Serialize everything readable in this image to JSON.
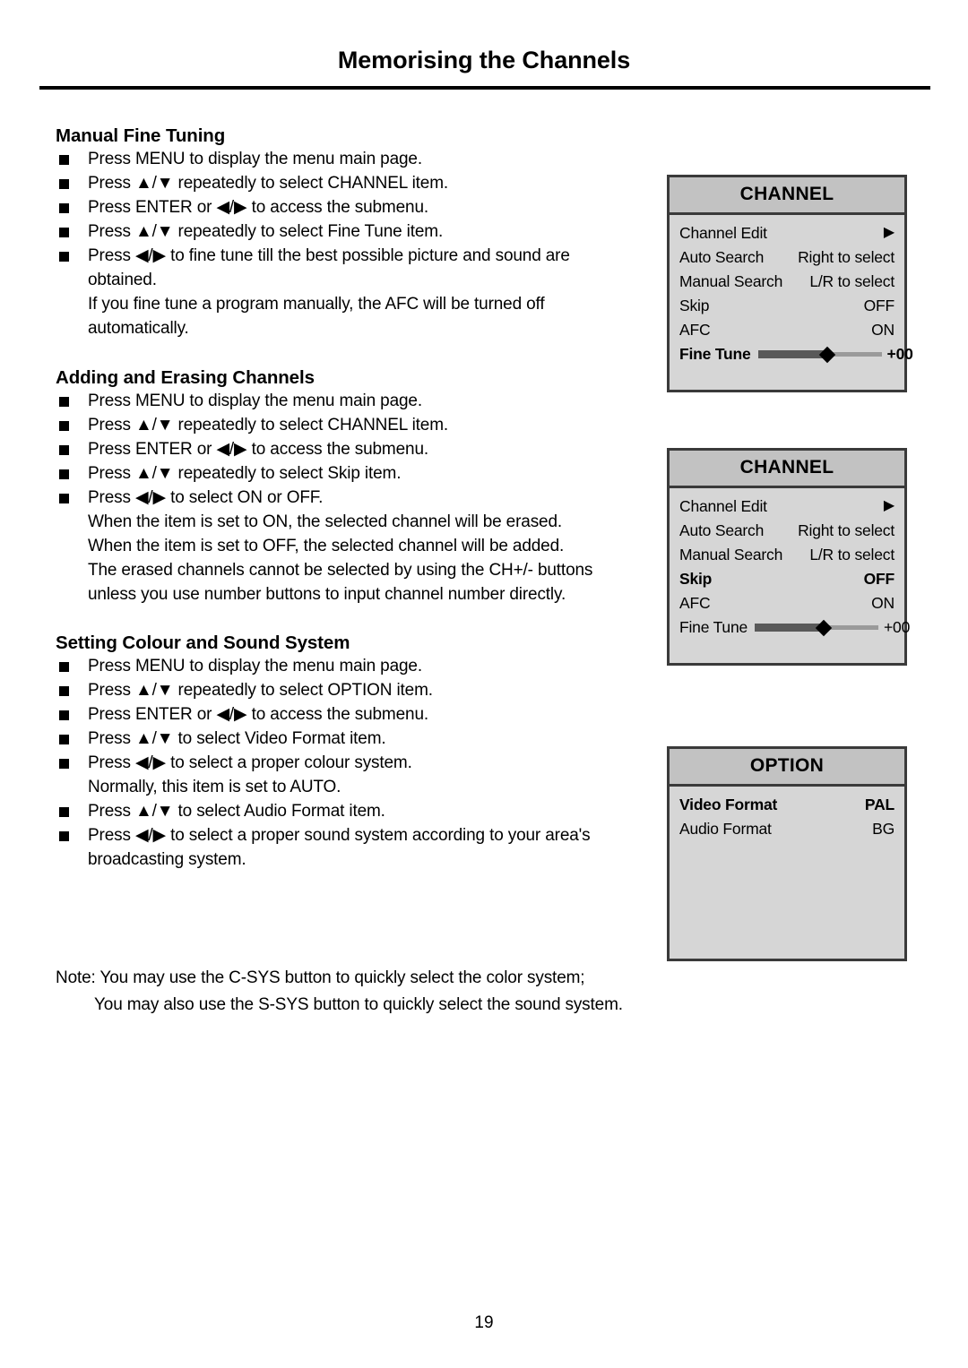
{
  "document": {
    "title": "Memorising the Channels",
    "page_number": "19"
  },
  "sections": [
    {
      "heading": "Manual Fine Tuning",
      "items": [
        {
          "type": "bullet",
          "text": "Press MENU to display the menu main page."
        },
        {
          "type": "bullet",
          "text": "Press ▲/▼ repeatedly to select CHANNEL item."
        },
        {
          "type": "bullet",
          "text": "Press ENTER or ◀/▶ to access the submenu."
        },
        {
          "type": "bullet",
          "text": "Press ▲/▼ repeatedly to select Fine Tune item."
        },
        {
          "type": "bullet",
          "text": "Press ◀/▶ to fine tune till the best possible picture and sound are"
        },
        {
          "type": "cont",
          "text": "obtained."
        },
        {
          "type": "cont",
          "text": "If you fine tune a program manually, the AFC will be turned off"
        },
        {
          "type": "cont",
          "text": "automatically."
        }
      ]
    },
    {
      "heading": "Adding and Erasing Channels",
      "items": [
        {
          "type": "bullet",
          "text": "Press MENU to display the menu main page."
        },
        {
          "type": "bullet",
          "text": "Press ▲/▼ repeatedly to select CHANNEL item."
        },
        {
          "type": "bullet",
          "text": "Press ENTER or ◀/▶ to access the submenu."
        },
        {
          "type": "bullet",
          "text": "Press ▲/▼ repeatedly to select Skip item."
        },
        {
          "type": "bullet",
          "text": "Press ◀/▶ to select ON or OFF."
        },
        {
          "type": "cont",
          "text": "When the item is set to ON, the selected channel will be erased."
        },
        {
          "type": "cont",
          "text": "When the item is set to OFF, the selected channel will be added."
        },
        {
          "type": "cont",
          "text": "The erased channels cannot be selected by using the CH+/- buttons"
        },
        {
          "type": "cont",
          "text": "unless you use number buttons to input channel number directly."
        }
      ]
    },
    {
      "heading": "Setting Colour and Sound System",
      "items": [
        {
          "type": "bullet",
          "text": "Press MENU to display the menu main page."
        },
        {
          "type": "bullet",
          "text": "Press ▲/▼ repeatedly to select OPTION item."
        },
        {
          "type": "bullet",
          "text": "Press ENTER or ◀/▶ to access the submenu."
        },
        {
          "type": "bullet",
          "text": "Press ▲/▼ to select Video Format item."
        },
        {
          "type": "bullet",
          "text": "Press ◀/▶ to select a proper colour system."
        },
        {
          "type": "cont",
          "text": "Normally, this item is set to AUTO."
        },
        {
          "type": "bullet",
          "text": "Press ▲/▼ to select Audio Format item."
        },
        {
          "type": "bullet",
          "text": "Press ◀/▶ to select a proper sound system according to your area's"
        },
        {
          "type": "cont",
          "text": "broadcasting system."
        }
      ]
    }
  ],
  "note": {
    "line1": "Note: You may use the C-SYS button to quickly select the color system;",
    "line2": "You may also use the S-SYS button to quickly select the sound system."
  },
  "osd": {
    "channel_fine_tune": {
      "title": "CHANNEL",
      "rows": [
        {
          "label": "Channel Edit",
          "value": "▶",
          "selected": false,
          "kind": "arrow"
        },
        {
          "label": "Auto Search",
          "value": "Right to select",
          "selected": false,
          "kind": "text"
        },
        {
          "label": "Manual Search",
          "value": "L/R to select",
          "selected": false,
          "kind": "text"
        },
        {
          "label": "Skip",
          "value": "OFF",
          "selected": false,
          "kind": "text"
        },
        {
          "label": "AFC",
          "value": "ON",
          "selected": false,
          "kind": "text"
        },
        {
          "label": "Fine Tune",
          "value": "+00",
          "selected": true,
          "kind": "slider"
        }
      ]
    },
    "channel_skip": {
      "title": "CHANNEL",
      "rows": [
        {
          "label": "Channel Edit",
          "value": "▶",
          "selected": false,
          "kind": "arrow"
        },
        {
          "label": "Auto Search",
          "value": "Right to select",
          "selected": false,
          "kind": "text"
        },
        {
          "label": "Manual Search",
          "value": "L/R to select",
          "selected": false,
          "kind": "text"
        },
        {
          "label": "Skip",
          "value": "OFF",
          "selected": true,
          "kind": "text"
        },
        {
          "label": "AFC",
          "value": "ON",
          "selected": false,
          "kind": "text"
        },
        {
          "label": "Fine Tune",
          "value": "+00",
          "selected": false,
          "kind": "slider"
        }
      ]
    },
    "option": {
      "title": "OPTION",
      "rows": [
        {
          "label": "Video Format",
          "value": "PAL",
          "selected": true,
          "kind": "text"
        },
        {
          "label": "Audio Format",
          "value": "BG",
          "selected": false,
          "kind": "text"
        }
      ]
    }
  },
  "colors": {
    "osd_body": "#d6d6d6",
    "osd_header": "#c2c2c2",
    "osd_border": "#3a3a3a",
    "slider_fill": "#595959",
    "slider_track": "#9a9a9a"
  }
}
